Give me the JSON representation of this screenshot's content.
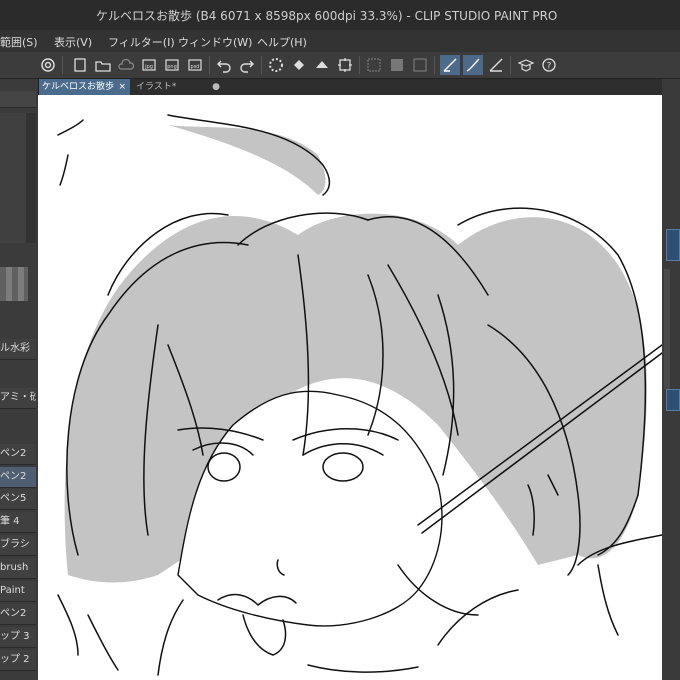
{
  "window": {
    "title": "ケルベロスお散歩 (B4 6071 x 8598px 600dpi 33.3%)  - CLIP STUDIO PAINT PRO"
  },
  "menu": [
    {
      "label": "範囲(S)"
    },
    {
      "label": "表示(V)"
    },
    {
      "label": "フィルター(I)"
    },
    {
      "label": "ウィンドウ(W)"
    },
    {
      "label": "ヘルプ(H)"
    }
  ],
  "tabs": [
    {
      "label": "ケルベロスお散歩",
      "close": "×",
      "active": true
    },
    {
      "label": "イラスト*",
      "close": "●",
      "active": false
    }
  ],
  "toolbar_icons": [
    "clip-studio-logo-icon",
    "new-file-icon",
    "open-file-icon",
    "save-cloud-icon",
    "export-jpg-icon",
    "export-png-icon",
    "export-psd-icon",
    "undo-icon",
    "redo-icon",
    "loading-icon",
    "fill-icon",
    "transform-icon",
    "deselect-icon",
    "invert-selection-icon",
    "select-all-icon",
    "pen-pressure-icon",
    "stroke-icon",
    "ruler-icon",
    "learn-icon",
    "help-icon"
  ],
  "left_panel": {
    "brush_items": [
      {
        "label": "ル水彩"
      },
      {
        "label": "アミ・砂"
      },
      {
        "label": "ペン2"
      },
      {
        "label": "ペン2"
      },
      {
        "label": "ペン5"
      },
      {
        "label": "筆 4"
      },
      {
        "label": "ブラシ"
      },
      {
        "label": "brush"
      },
      {
        "label": "Paint"
      },
      {
        "label": "ペン2"
      },
      {
        "label": "ップ 3"
      },
      {
        "label": "ップ 2"
      }
    ]
  },
  "colors": {
    "accent": "#4a6b8c",
    "canvas": "#ffffff",
    "panel": "#3b3b3b",
    "line": "#111111",
    "hair": "#c4c4c4"
  }
}
